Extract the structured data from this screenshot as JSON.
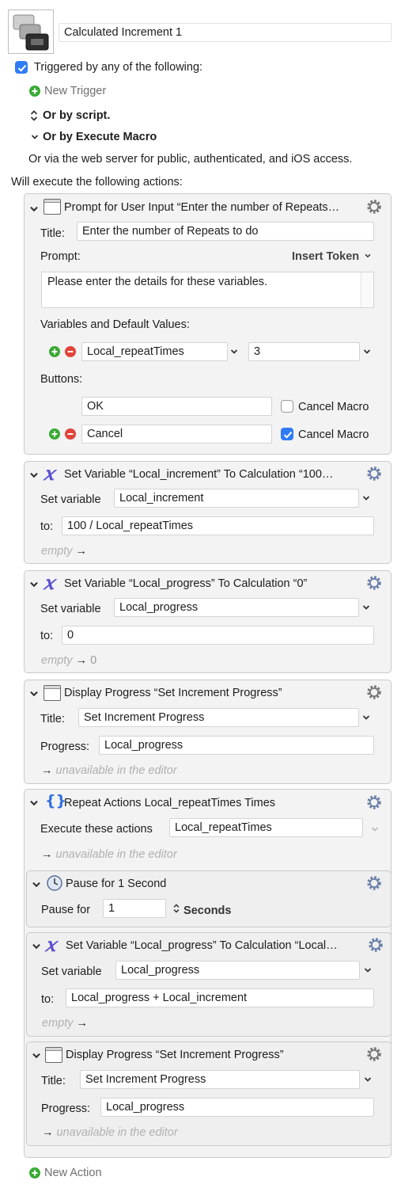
{
  "macro": {
    "name": "Calculated Increment 1"
  },
  "triggers": {
    "heading": "Triggered by any of the following:",
    "new_trigger": "New Trigger",
    "by_script": "Or by script.",
    "by_execute": "Or by Execute Macro",
    "web_server": "Or via the web server for public, authenticated, and iOS access."
  },
  "actions_heading": "Will execute the following actions:",
  "a1": {
    "title": "Prompt for User Input “Enter the number of Repeats…",
    "title_label": "Title:",
    "title_value": "Enter the number of Repeats to do",
    "prompt_label": "Prompt:",
    "insert_token": "Insert Token",
    "prompt_text": "Please enter the details for these variables.",
    "vars_label": "Variables and Default Values:",
    "var_name": "Local_repeatTimes",
    "var_value": "3",
    "buttons_label": "Buttons:",
    "btn1": "OK",
    "btn2": "Cancel",
    "cancel_macro": "Cancel Macro"
  },
  "a2": {
    "title": "Set Variable “Local_increment” To Calculation “100…",
    "set_label": "Set variable",
    "var": "Local_increment",
    "to_label": "to:",
    "to_value": "100 / Local_repeatTimes",
    "result_empty": "empty",
    "result_arrow": "→",
    "result_value": ""
  },
  "a3": {
    "title": "Set Variable “Local_progress” To Calculation “0”",
    "set_label": "Set variable",
    "var": "Local_progress",
    "to_label": "to:",
    "to_value": "0",
    "result_empty": "empty",
    "result_arrow": "→",
    "result_value": "0"
  },
  "a4": {
    "title": "Display Progress “Set Increment Progress”",
    "title_label": "Title:",
    "title_value": "Set Increment Progress",
    "progress_label": "Progress:",
    "progress_value": "Local_progress",
    "result_arrow": "→",
    "unavailable": "unavailable in the editor"
  },
  "a5": {
    "title": "Repeat Actions Local_repeatTimes Times",
    "exec_label": "Execute these actions",
    "exec_value": "Local_repeatTimes",
    "result_arrow": "→",
    "unavailable": "unavailable in the editor"
  },
  "a6": {
    "title": "Pause for 1 Second",
    "pause_label": "Pause for",
    "pause_value": "1",
    "unit": "Seconds"
  },
  "a7": {
    "title": "Set Variable “Local_progress” To Calculation “Local…",
    "set_label": "Set variable",
    "var": "Local_progress",
    "to_label": "to:",
    "to_value": "Local_progress + Local_increment",
    "result_empty": "empty",
    "result_arrow": "→"
  },
  "a8": {
    "title": "Display Progress “Set Increment Progress”",
    "title_label": "Title:",
    "title_value": "Set Increment Progress",
    "progress_label": "Progress:",
    "progress_value": "Local_progress",
    "result_arrow": "→",
    "unavailable": "unavailable in the editor"
  },
  "new_action": "New Action",
  "colors": {
    "accent": "#2f7cf6",
    "plus": "#3aaa35",
    "minus": "#e0443a",
    "x_icon": "#5a4fcf",
    "repeat_icon": "#2f6fe0"
  }
}
